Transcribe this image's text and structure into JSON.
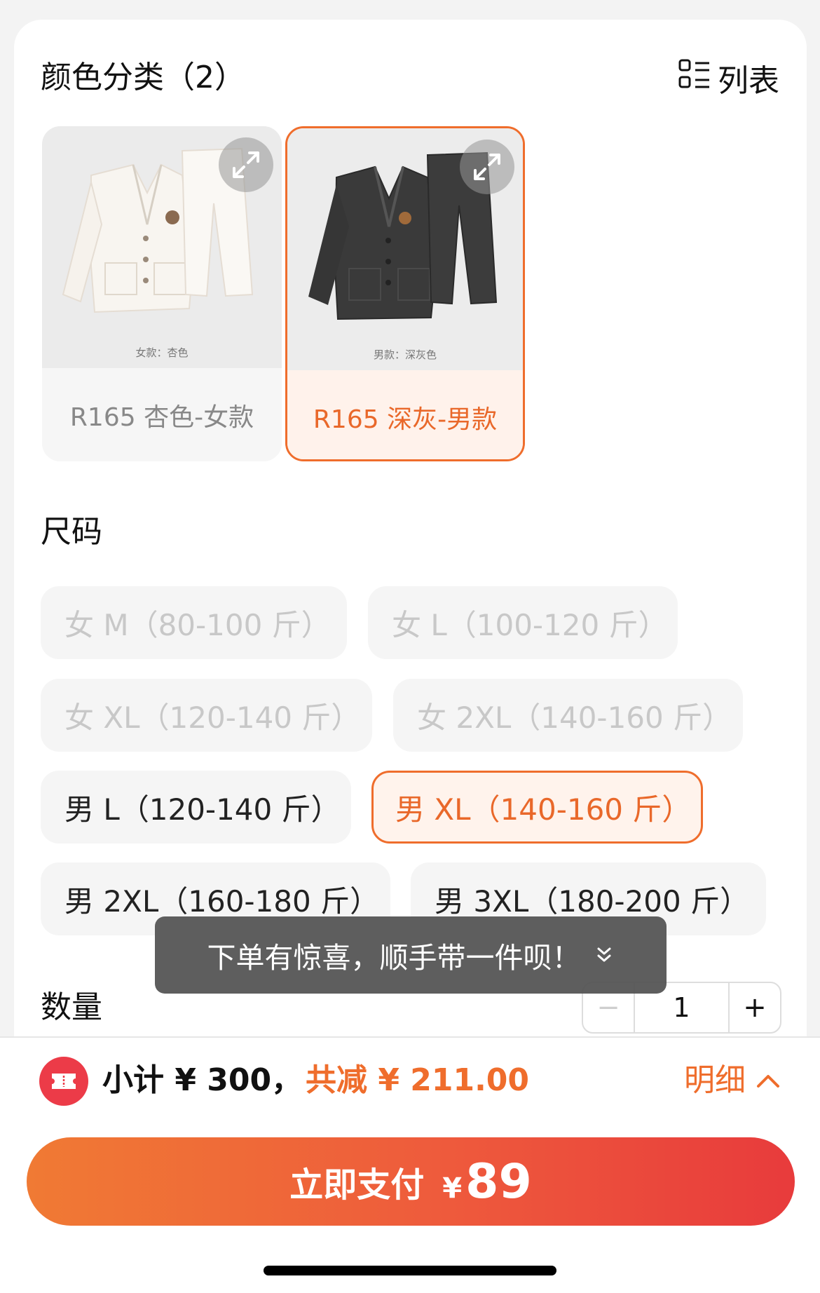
{
  "color_section": {
    "title": "颜色分类（2）",
    "list_toggle_label": "列表",
    "variants": [
      {
        "name": "R165 杏色-女款",
        "caption": "女款：杏色",
        "selected": false
      },
      {
        "name": "R165 深灰-男款",
        "caption": "男款：深灰色",
        "selected": true
      }
    ]
  },
  "size_section": {
    "title": "尺码",
    "options": [
      {
        "label": "女 M（80-100 斤）",
        "state": "disabled"
      },
      {
        "label": "女 L（100-120 斤）",
        "state": "disabled"
      },
      {
        "label": "女 XL（120-140 斤）",
        "state": "disabled"
      },
      {
        "label": "女 2XL（140-160 斤）",
        "state": "disabled"
      },
      {
        "label": "男 L（120-140 斤）",
        "state": "available"
      },
      {
        "label": "男 XL（140-160 斤）",
        "state": "selected"
      },
      {
        "label": "男 2XL（160-180 斤）",
        "state": "available"
      },
      {
        "label": "男 3XL（180-200 斤）",
        "state": "available"
      }
    ]
  },
  "toast": {
    "text": "下单有惊喜，顺手带一件呗！"
  },
  "quantity": {
    "title": "数量",
    "value": "1",
    "minus": "−",
    "plus": "+"
  },
  "summary": {
    "subtotal": "小计 ¥ 300，",
    "discount": "共减 ¥ 211.00",
    "detail_label": "明细"
  },
  "pay": {
    "label": "立即支付",
    "currency": "¥",
    "amount": "89"
  },
  "colors": {
    "accent": "#ef6d2c",
    "pay_gradient_start": "#f07a34",
    "pay_gradient_end": "#e83b3c",
    "coupon_red": "#ec3b48"
  }
}
